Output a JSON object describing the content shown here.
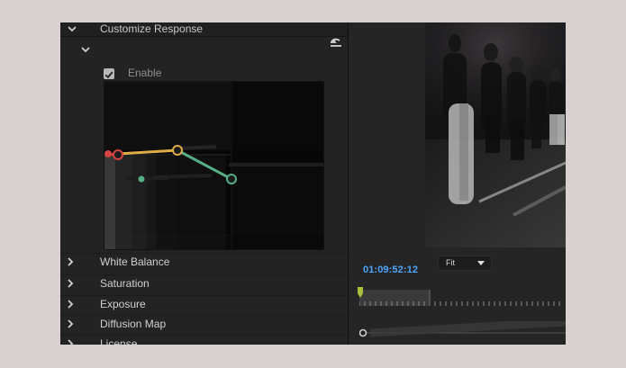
{
  "panel": {
    "header_title": "Customize Response",
    "enable_label": "Enable",
    "enable_checked": true,
    "reset_icon": "undo-icon",
    "menu_items": [
      {
        "label": "White Balance"
      },
      {
        "label": "Saturation"
      },
      {
        "label": "Exposure"
      },
      {
        "label": "Diffusion Map"
      },
      {
        "label": "License"
      }
    ]
  },
  "viewer": {
    "timecode": "01:09:52:12",
    "fit_label": "Fit",
    "playhead_progress": 0.02,
    "in_out_range": [
      0,
      0.35
    ]
  },
  "graph": {
    "accent_red": "#e14a4a",
    "accent_yellow": "#e3b44d",
    "accent_green": "#58b38a",
    "points": [
      {
        "label": "red-handle"
      },
      {
        "label": "yellow-handle"
      },
      {
        "label": "green-handle"
      }
    ]
  }
}
